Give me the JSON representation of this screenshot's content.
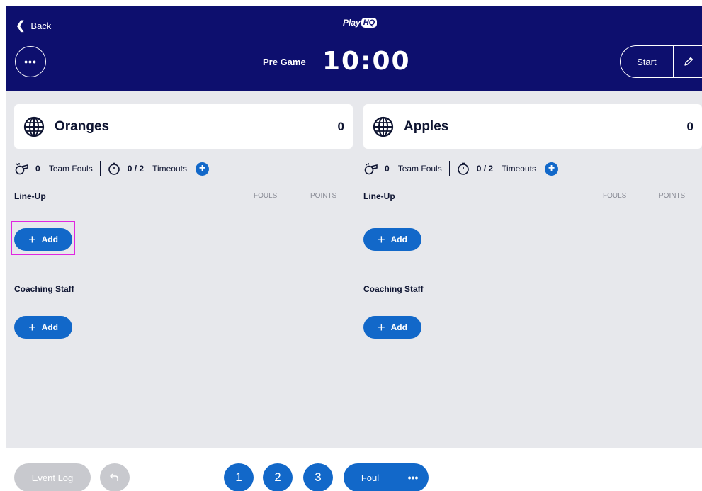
{
  "header": {
    "back_label": "Back",
    "logo_play": "Play",
    "logo_hq": "HQ",
    "more_label": "•••",
    "period": "Pre Game",
    "clock": "10:00",
    "start_label": "Start"
  },
  "teams": [
    {
      "name": "Oranges",
      "score": "0",
      "fouls_count": "0",
      "fouls_label": "Team Fouls",
      "timeouts_count": "0 / 2",
      "timeouts_label": "Timeouts",
      "lineup_label": "Line-Up",
      "col_fouls": "FOULS",
      "col_points": "POINTS",
      "lineup_add": "Add",
      "staff_label": "Coaching Staff",
      "staff_add": "Add"
    },
    {
      "name": "Apples",
      "score": "0",
      "fouls_count": "0",
      "fouls_label": "Team Fouls",
      "timeouts_count": "0 / 2",
      "timeouts_label": "Timeouts",
      "lineup_label": "Line-Up",
      "col_fouls": "FOULS",
      "col_points": "POINTS",
      "lineup_add": "Add",
      "staff_label": "Coaching Staff",
      "staff_add": "Add"
    }
  ],
  "footer": {
    "event_log": "Event Log",
    "points": [
      "1",
      "2",
      "3"
    ],
    "foul": "Foul",
    "foul_more": "•••"
  },
  "colors": {
    "header_bg": "#0d0f6e",
    "accent": "#1268c9",
    "panel_bg": "#e7e8ec",
    "highlight": "#e026e0"
  },
  "icons": {
    "back": "chevron-left-icon",
    "team": "globe-icon",
    "fouls": "whistle-icon",
    "timeouts": "stopwatch-icon",
    "add": "plus-icon",
    "edit": "pencil-icon",
    "undo": "undo-icon"
  }
}
